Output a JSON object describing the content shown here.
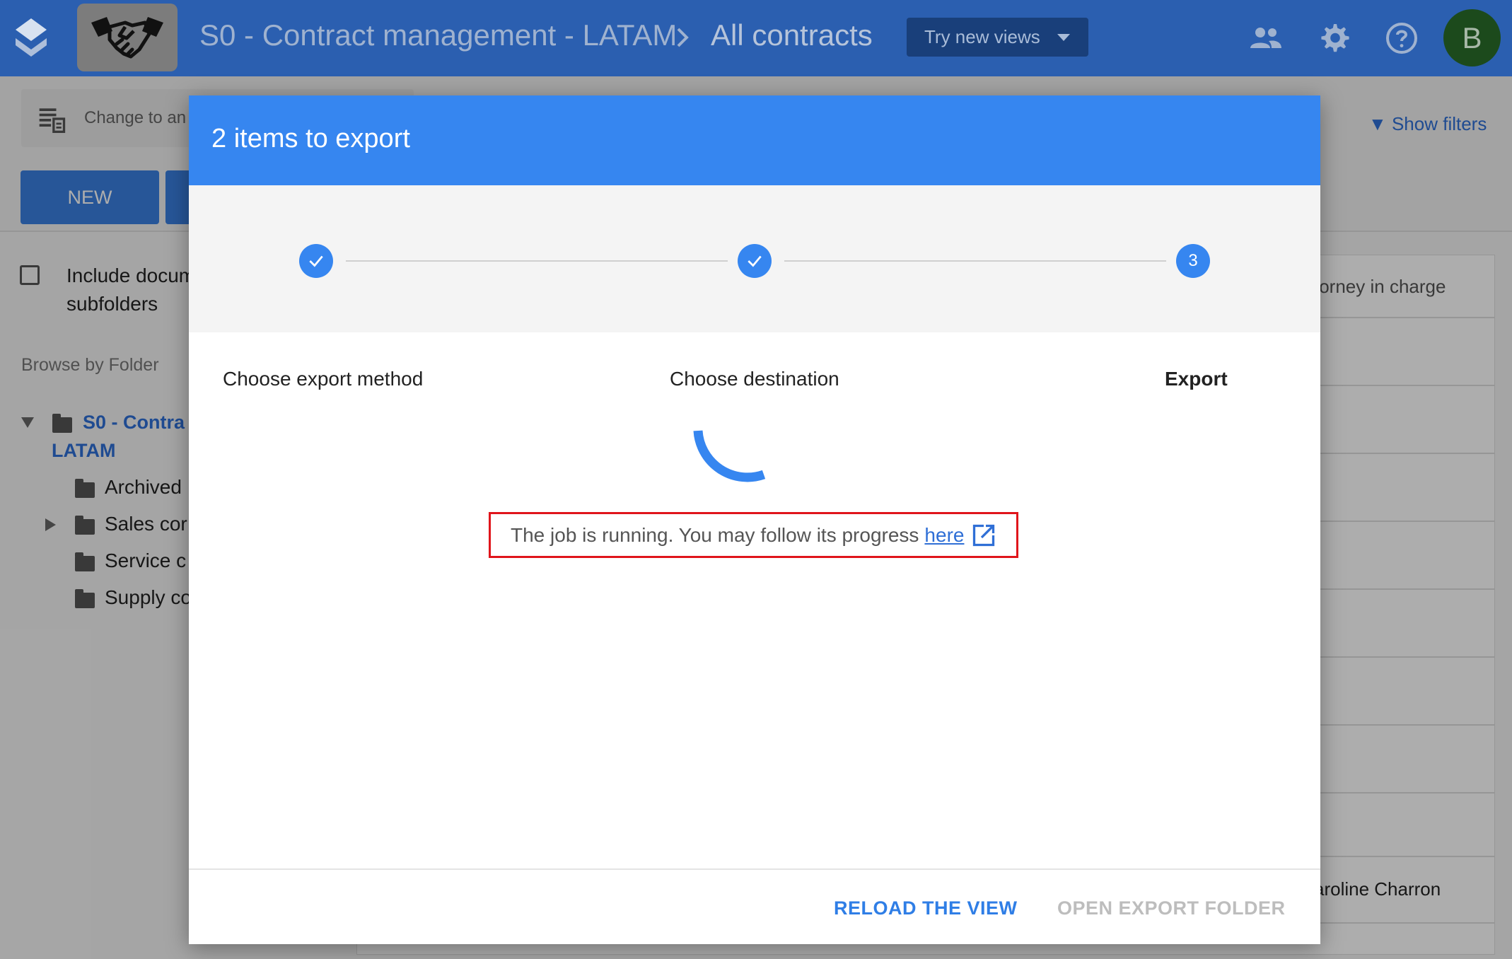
{
  "header": {
    "breadcrumb_1": "S0 - Contract management - LATAM",
    "breadcrumb_2": "All contracts",
    "try_views_label": "Try new views",
    "avatar_initial": "B"
  },
  "toolbar": {
    "change_view_label": "Change to an",
    "new_button_label": "NEW",
    "show_filters_label": "▼ Show filters"
  },
  "sidebar": {
    "include_label": "Include documents in subfolders",
    "include_label_visible": "Include docum",
    "include_label_line2": "subfolders",
    "browse_label": "Browse by Folder",
    "root_folder_line1": "S0 - Contra",
    "root_folder_line2": "LATAM",
    "folders": [
      "Archived",
      "Sales cor",
      "Service c",
      "Supply co"
    ]
  },
  "grid": {
    "column_attorney": "torney in charge",
    "row_value": "aroline Charron"
  },
  "dialog": {
    "title": "2 items to export",
    "steps": [
      {
        "label": "Choose export method",
        "state": "done"
      },
      {
        "label": "Choose destination",
        "state": "done"
      },
      {
        "label": "Export",
        "state": "active",
        "number": "3"
      }
    ],
    "job_message": "The job is running. You may follow its progress",
    "job_link": "here",
    "reload_button": "RELOAD THE VIEW",
    "open_folder_button": "OPEN EXPORT FOLDER"
  },
  "colors": {
    "topbar": "#2b5fb0",
    "dialog_header": "#3686f0",
    "accent": "#2f6fd6",
    "highlight_border": "#e0151b"
  }
}
